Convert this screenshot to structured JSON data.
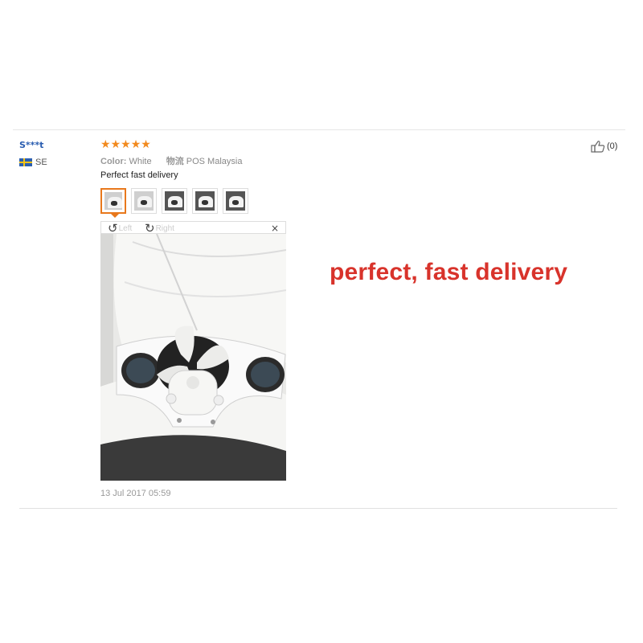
{
  "review": {
    "user_name": "S***t",
    "country_code": "SE",
    "rating": 5,
    "stars": [
      "★",
      "★",
      "★",
      "★",
      "★"
    ],
    "color_label": "Color:",
    "color_value": "White",
    "shipping_label": "物流",
    "shipping_value": "POS Malaysia",
    "text": "Perfect fast delivery",
    "thumbnails": [
      "photo-1",
      "photo-2",
      "photo-3",
      "photo-4",
      "photo-5"
    ],
    "viewer": {
      "rotate_left_label": "Left",
      "rotate_right_label": "Right",
      "close_glyph": "×"
    },
    "date": "13 Jul 2017 05:59",
    "helpful_count": "(0)"
  },
  "caption": "perfect, fast delivery",
  "colors": {
    "star": "#f28a1e",
    "username": "#2a5db0",
    "caption": "#d8332b",
    "thumb_active_border": "#e8781c"
  },
  "icons": [
    "flag-se-icon",
    "star-icon",
    "rotate-left-icon",
    "rotate-right-icon",
    "close-icon",
    "thumbs-up-icon"
  ]
}
